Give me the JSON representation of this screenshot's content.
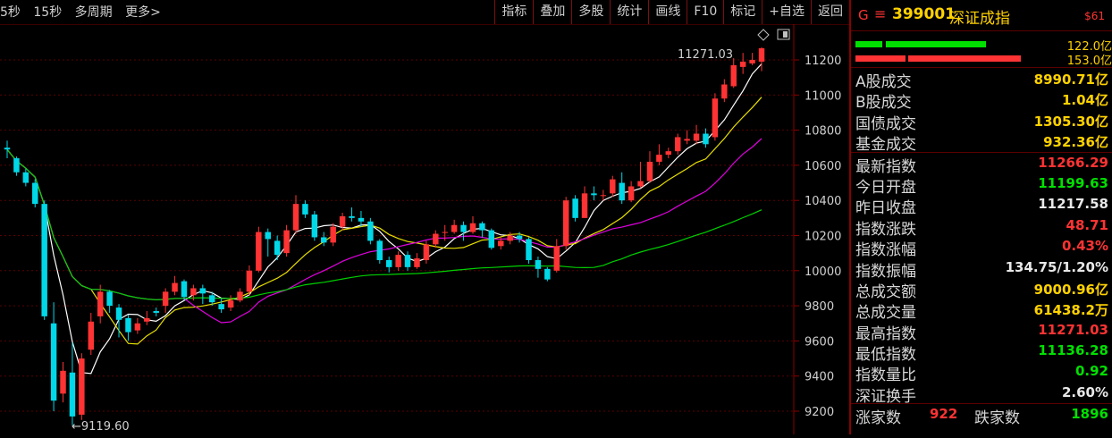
{
  "toolbar": {
    "left": [
      "5秒",
      "15秒",
      "多周期",
      "更多>"
    ],
    "right": [
      "指标",
      "叠加",
      "多股",
      "统计",
      "画线",
      "F10",
      "标记",
      "+自选",
      "返回"
    ]
  },
  "chart": {
    "y_ticks": [
      "11200",
      "11000",
      "10800",
      "10600",
      "10400",
      "10200",
      "10000",
      "9800",
      "9600",
      "9400",
      "9200"
    ],
    "high_label": "11271.03",
    "low_label": "←9119.60",
    "colors": {
      "up": "#ff3333",
      "down": "#00d8e8",
      "ma5": "#ffffff",
      "ma10": "#e8e000",
      "ma20": "#e000e0",
      "ma60": "#00d000",
      "grid": "#5a0000"
    }
  },
  "chart_data": {
    "type": "candlestick",
    "ylim": [
      9100,
      11350
    ],
    "candles": [
      [
        10700,
        10690,
        10740,
        10640
      ],
      [
        10640,
        10560,
        10650,
        10540
      ],
      [
        10560,
        10500,
        10580,
        10480
      ],
      [
        10500,
        10380,
        10520,
        10360
      ],
      [
        10380,
        9740,
        10400,
        9720
      ],
      [
        9700,
        9260,
        9820,
        9200
      ],
      [
        9300,
        9430,
        9480,
        9250
      ],
      [
        9420,
        9170,
        9590,
        9120
      ],
      [
        9180,
        9500,
        9530,
        9150
      ],
      [
        9550,
        9710,
        9760,
        9520
      ],
      [
        9740,
        9880,
        9920,
        9700
      ],
      [
        9880,
        9800,
        9890,
        9760
      ],
      [
        9790,
        9720,
        9810,
        9620
      ],
      [
        9730,
        9650,
        9750,
        9600
      ],
      [
        9660,
        9700,
        9730,
        9640
      ],
      [
        9710,
        9730,
        9770,
        9690
      ],
      [
        9770,
        9760,
        9790,
        9740
      ],
      [
        9800,
        9880,
        9900,
        9760
      ],
      [
        9880,
        9930,
        9970,
        9860
      ],
      [
        9940,
        9850,
        9950,
        9830
      ],
      [
        9860,
        9900,
        9920,
        9830
      ],
      [
        9900,
        9870,
        9920,
        9810
      ],
      [
        9860,
        9820,
        9880,
        9800
      ],
      [
        9810,
        9780,
        9840,
        9760
      ],
      [
        9790,
        9830,
        9860,
        9770
      ],
      [
        9830,
        9880,
        9900,
        9820
      ],
      [
        9880,
        10000,
        10030,
        9860
      ],
      [
        10000,
        10220,
        10250,
        9990
      ],
      [
        10220,
        10180,
        10240,
        10080
      ],
      [
        10170,
        10090,
        10200,
        10060
      ],
      [
        10100,
        10230,
        10260,
        10080
      ],
      [
        10230,
        10380,
        10430,
        10210
      ],
      [
        10380,
        10320,
        10400,
        10300
      ],
      [
        10320,
        10190,
        10340,
        10170
      ],
      [
        10190,
        10160,
        10220,
        10140
      ],
      [
        10160,
        10250,
        10270,
        10140
      ],
      [
        10250,
        10310,
        10330,
        10230
      ],
      [
        10310,
        10300,
        10360,
        10280
      ],
      [
        10300,
        10280,
        10340,
        10250
      ],
      [
        10280,
        10170,
        10300,
        10150
      ],
      [
        10170,
        10060,
        10180,
        10040
      ],
      [
        10060,
        10020,
        10080,
        9990
      ],
      [
        10020,
        10090,
        10110,
        10000
      ],
      [
        10090,
        10020,
        10110,
        10000
      ],
      [
        10020,
        10070,
        10100,
        10010
      ],
      [
        10060,
        10150,
        10170,
        10040
      ],
      [
        10150,
        10210,
        10230,
        10130
      ],
      [
        10220,
        10220,
        10260,
        10170
      ],
      [
        10220,
        10260,
        10290,
        10210
      ],
      [
        10260,
        10220,
        10280,
        10170
      ],
      [
        10220,
        10270,
        10310,
        10210
      ],
      [
        10270,
        10230,
        10280,
        10190
      ],
      [
        10230,
        10130,
        10240,
        10120
      ],
      [
        10140,
        10170,
        10190,
        10120
      ],
      [
        10170,
        10200,
        10220,
        10150
      ],
      [
        10200,
        10180,
        10220,
        10160
      ],
      [
        10180,
        10060,
        10190,
        10040
      ],
      [
        10060,
        10010,
        10080,
        9960
      ],
      [
        10010,
        9950,
        10020,
        9940
      ],
      [
        10000,
        10140,
        10180,
        9990
      ],
      [
        10140,
        10400,
        10420,
        10120
      ],
      [
        10410,
        10300,
        10430,
        10280
      ],
      [
        10300,
        10440,
        10480,
        10300
      ],
      [
        10440,
        10430,
        10480,
        10400
      ],
      [
        10430,
        10430,
        10460,
        10400
      ],
      [
        10440,
        10520,
        10540,
        10420
      ],
      [
        10500,
        10400,
        10560,
        10380
      ],
      [
        10400,
        10480,
        10510,
        10390
      ],
      [
        10480,
        10510,
        10620,
        10470
      ],
      [
        10510,
        10620,
        10680,
        10500
      ],
      [
        10620,
        10660,
        10720,
        10600
      ],
      [
        10660,
        10680,
        10700,
        10640
      ],
      [
        10680,
        10760,
        10780,
        10660
      ],
      [
        10740,
        10750,
        10800,
        10720
      ],
      [
        10740,
        10780,
        10830,
        10720
      ],
      [
        10780,
        10720,
        10810,
        10700
      ],
      [
        10760,
        10980,
        11010,
        10740
      ],
      [
        10980,
        11060,
        11090,
        10960
      ],
      [
        11050,
        11170,
        11210,
        11040
      ],
      [
        11160,
        11190,
        11240,
        11120
      ],
      [
        11180,
        11200,
        11240,
        11170
      ],
      [
        11190,
        11266,
        11271,
        11136
      ]
    ]
  },
  "sidebar": {
    "code": "399001",
    "name": "深证成指",
    "tag": "$61",
    "bar_values": [
      "122.0亿",
      "153.0亿"
    ],
    "rows": [
      {
        "label": "A股成交",
        "value": "8990.71亿",
        "color": "#ffd200"
      },
      {
        "label": "B股成交",
        "value": "1.04亿",
        "color": "#ffd200"
      },
      {
        "label": "国债成交",
        "value": "1305.30亿",
        "color": "#ffd200"
      },
      {
        "label": "基金成交",
        "value": "932.36亿",
        "color": "#ffd200"
      },
      {
        "label": "最新指数",
        "value": "11266.29",
        "color": "#ff3333"
      },
      {
        "label": "今日开盘",
        "value": "11199.63",
        "color": "#00e000"
      },
      {
        "label": "昨日收盘",
        "value": "11217.58",
        "color": "#e8e8e8"
      },
      {
        "label": "指数涨跌",
        "value": "48.71",
        "color": "#ff3333"
      },
      {
        "label": "指数涨幅",
        "value": "0.43%",
        "color": "#ff3333"
      },
      {
        "label": "指数振幅",
        "value": "134.75/1.20%",
        "color": "#e8e8e8"
      },
      {
        "label": "总成交额",
        "value": "9000.96亿",
        "color": "#ffd200"
      },
      {
        "label": "总成交量",
        "value": "61438.2万",
        "color": "#ffd200"
      },
      {
        "label": "最高指数",
        "value": "11271.03",
        "color": "#ff3333"
      },
      {
        "label": "最低指数",
        "value": "11136.28",
        "color": "#00e000"
      },
      {
        "label": "指数量比",
        "value": "0.92",
        "color": "#00e000"
      },
      {
        "label": "深证换手",
        "value": "2.60%",
        "color": "#e8e8e8"
      }
    ],
    "bottom": {
      "up_label": "涨家数",
      "up_value": "922",
      "down_label": "跌家数",
      "down_value": "1896"
    }
  }
}
